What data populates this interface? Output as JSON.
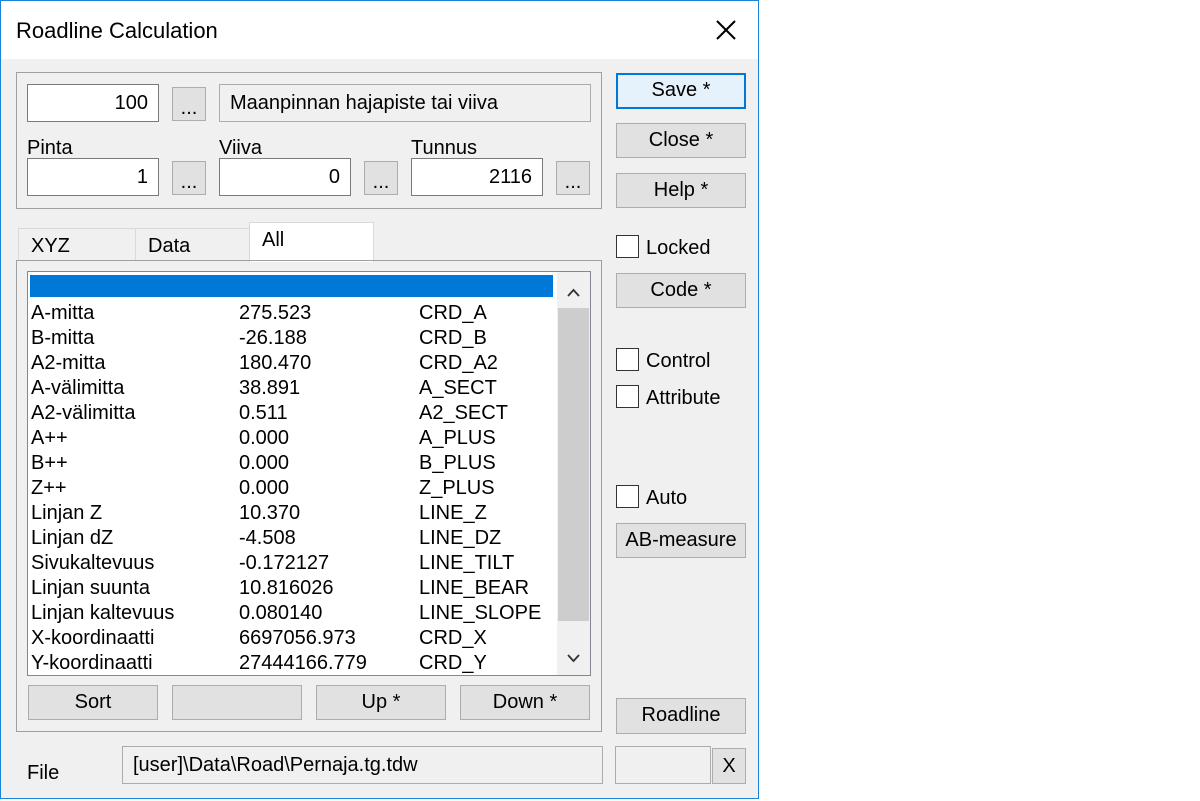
{
  "window": {
    "title": "Roadline Calculation"
  },
  "top": {
    "code_value": "100",
    "browse": "...",
    "description": "Maanpinnan hajapiste tai viiva",
    "pinta_label": "Pinta",
    "pinta_value": "1",
    "viiva_label": "Viiva",
    "viiva_value": "0",
    "tunnus_label": "Tunnus",
    "tunnus_value": "2116"
  },
  "tabs": [
    "XYZ",
    "Data",
    "All"
  ],
  "list": {
    "rows": [
      {
        "name": "A-mitta",
        "value": "275.523",
        "code": "CRD_A"
      },
      {
        "name": "B-mitta",
        "value": "-26.188",
        "code": "CRD_B"
      },
      {
        "name": "A2-mitta",
        "value": "180.470",
        "code": "CRD_A2"
      },
      {
        "name": "A-välimitta",
        "value": "38.891",
        "code": "A_SECT"
      },
      {
        "name": "A2-välimitta",
        "value": "0.511",
        "code": "A2_SECT"
      },
      {
        "name": "A++",
        "value": "0.000",
        "code": "A_PLUS"
      },
      {
        "name": "B++",
        "value": "0.000",
        "code": "B_PLUS"
      },
      {
        "name": "Z++",
        "value": "0.000",
        "code": "Z_PLUS"
      },
      {
        "name": "Linjan Z",
        "value": "10.370",
        "code": "LINE_Z"
      },
      {
        "name": "Linjan dZ",
        "value": "-4.508",
        "code": "LINE_DZ"
      },
      {
        "name": "Sivukaltevuus",
        "value": "-0.172127",
        "code": "LINE_TILT"
      },
      {
        "name": "Linjan suunta",
        "value": "10.816026",
        "code": "LINE_BEAR"
      },
      {
        "name": "Linjan kaltevuus",
        "value": "0.080140",
        "code": "LINE_SLOPE"
      },
      {
        "name": "X-koordinaatti",
        "value": "6697056.973",
        "code": "CRD_X"
      },
      {
        "name": "Y-koordinaatti",
        "value": "27444166.779",
        "code": "CRD_Y"
      }
    ]
  },
  "bottom_buttons": {
    "sort": "Sort",
    "blank": "",
    "up": "Up *",
    "down": "Down *"
  },
  "right": {
    "save": "Save *",
    "close": "Close *",
    "help": "Help *",
    "locked": "Locked",
    "code": "Code *",
    "control": "Control",
    "attribute": "Attribute",
    "auto": "Auto",
    "ab_measure": "AB-measure",
    "roadline": "Roadline",
    "x_button": "X"
  },
  "file": {
    "label": "File",
    "path": "[user]\\Data\\Road\\Pernaja.tg.tdw",
    "extra": ""
  }
}
